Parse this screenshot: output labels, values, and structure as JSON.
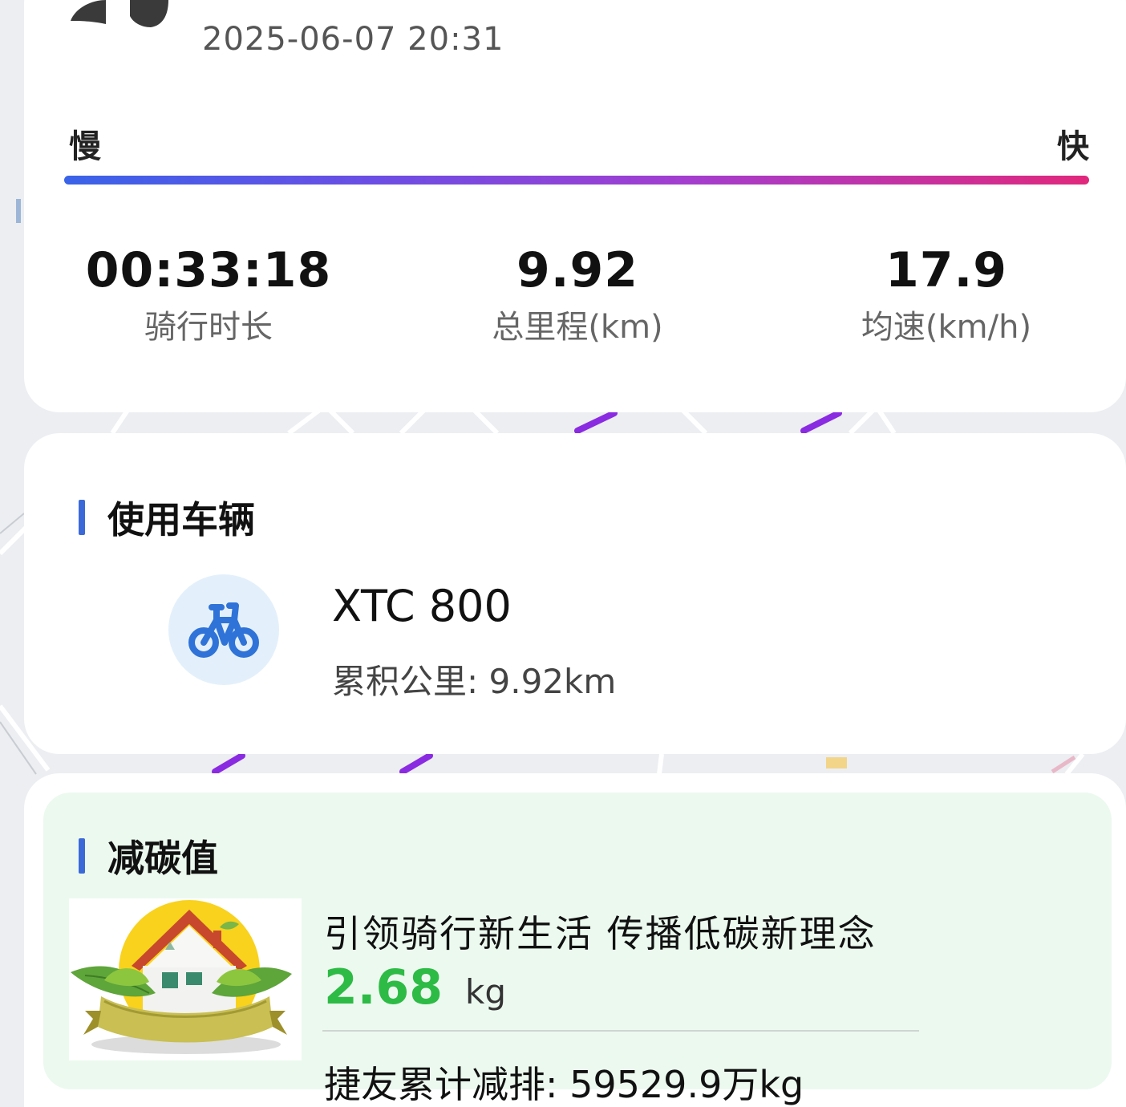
{
  "ride": {
    "datetime": "2025-06-07 20:31",
    "speed_scale": {
      "slow_label": "慢",
      "fast_label": "快"
    },
    "stats": {
      "duration": {
        "value": "00:33:18",
        "label": "骑行时长"
      },
      "distance": {
        "value": "9.92",
        "label": "总里程(km)"
      },
      "avg_speed": {
        "value": "17.9",
        "label": "均速(km/h)"
      }
    }
  },
  "vehicle": {
    "section_title": "使用车辆",
    "icon": "bicycle-icon",
    "name": "XTC 800",
    "mileage": "累积公里: 9.92km"
  },
  "carbon": {
    "section_title": "减碳值",
    "image": "eco-house-icon",
    "slogan": "引领骑行新生活 传播低碳新理念",
    "value": "2.68",
    "unit": "kg",
    "total": "捷友累计减排: 59529.9万kg"
  },
  "colors": {
    "accent": "#3b6ad8",
    "carbon_green": "#2dbb45",
    "route_purple": "#8a2be2",
    "speed_gradient": [
      "#3a63e8",
      "#a23ed0",
      "#e0287c"
    ]
  }
}
